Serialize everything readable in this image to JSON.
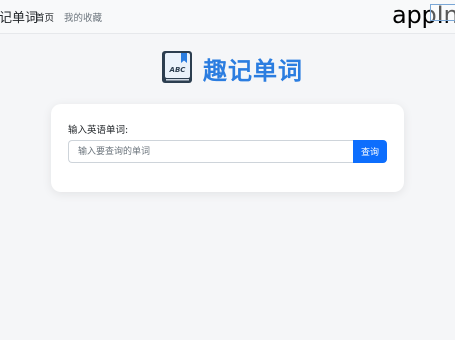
{
  "navbar": {
    "brand": "趣记单词",
    "links": [
      {
        "label": "首页"
      },
      {
        "label": "我的收藏"
      }
    ],
    "overlay_text": "appIn"
  },
  "logo": {
    "icon_text": "ABC",
    "title": "趣记单词"
  },
  "search": {
    "label": "输入英语单词:",
    "placeholder": "输入要查询的单词",
    "value": "",
    "button_label": "查询"
  },
  "colors": {
    "accent": "#2b7de0",
    "button": "#0d6efd",
    "background": "#f5f6f8"
  }
}
